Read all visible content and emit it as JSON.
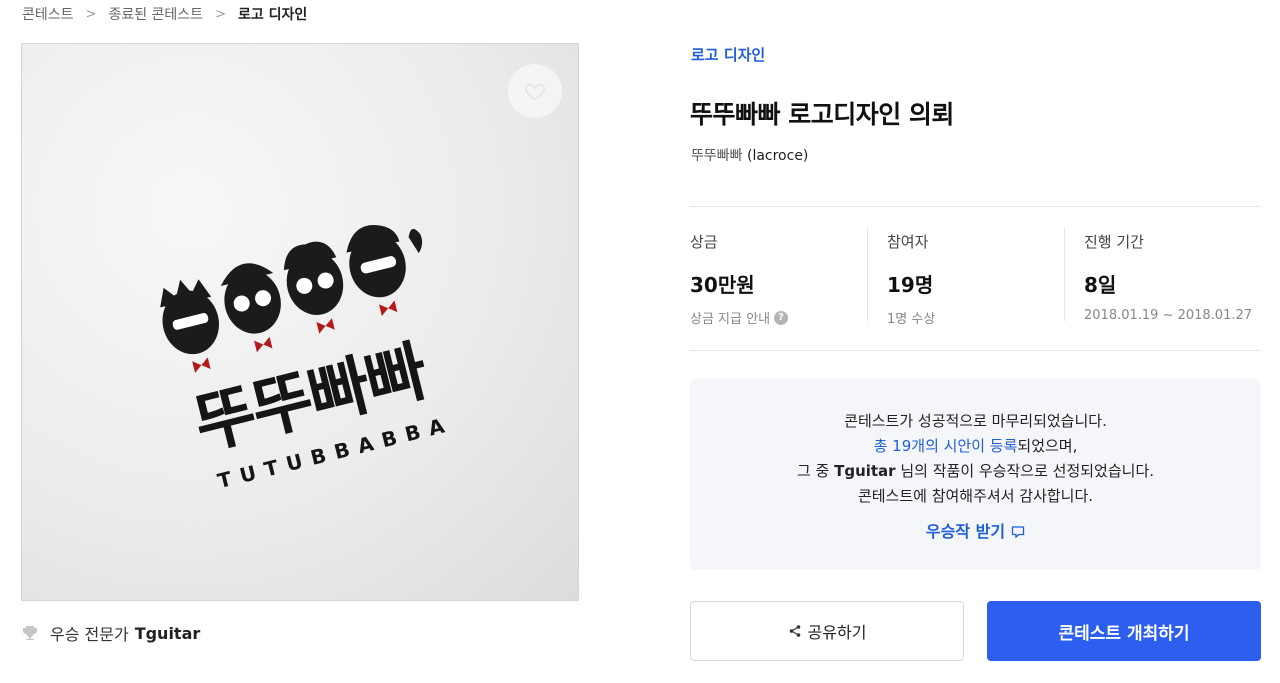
{
  "breadcrumb": {
    "items": [
      "콘테스트",
      "종료된 콘테스트",
      "로고 디자인"
    ],
    "separator": ">"
  },
  "image": {
    "logo_text_korean": "뚜뚜빠빠",
    "logo_text_latin": "TUTUBBABBA"
  },
  "winner": {
    "label": "우승 전문가",
    "name": "Tguitar",
    "icon": "trophy-icon"
  },
  "contest": {
    "category": "로고 디자인",
    "title": "뚜뚜빠빠 로고디자인 의뢰",
    "client_name": "뚜뚜빠빠",
    "client_handle": "(lacroce)"
  },
  "stats": {
    "prize": {
      "label": "상금",
      "value": "30만원",
      "sub": "상금 지급 안내",
      "help_icon": "?"
    },
    "participants": {
      "label": "참여자",
      "value": "19명",
      "sub": "1명 수상"
    },
    "period": {
      "label": "진행 기간",
      "value": "8일",
      "sub": "2018.01.19 ~ 2018.01.27"
    }
  },
  "notice": {
    "line1": "콘테스트가 성공적으로 마무리되었습니다.",
    "line2_link": "총 19개의 시안이 등록",
    "line2_rest": "되었으며,",
    "line3_pre": "그 중 ",
    "line3_name": "Tguitar",
    "line3_post": " 님의 작품이 우승작으로 선정되었습니다.",
    "line4": "콘테스트에 참여해주셔서 감사합니다.",
    "link_label": "우승작 받기"
  },
  "buttons": {
    "share_label": "공유하기",
    "host_label": "콘테스트 개최하기"
  },
  "colors": {
    "accent": "#2c5ef0",
    "link": "#1f5fd6",
    "notice_bg": "#f4f6f9"
  }
}
